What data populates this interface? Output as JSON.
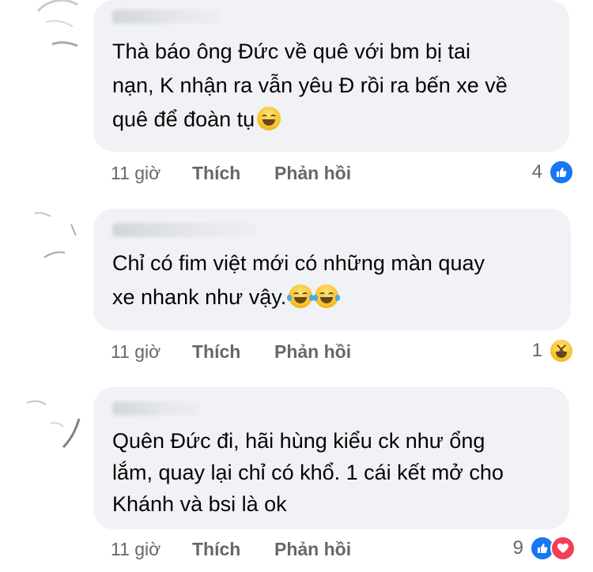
{
  "comments": [
    {
      "text": "Thà báo ông Đức về quê với bm bị tai\nnạn, K nhận ra vẫn yêu Đ rồi ra bến xe về\nquê để đoàn tụ",
      "emoji": "grinning-face-emoji",
      "time": "11 giờ",
      "like_label": "Thích",
      "reply_label": "Phản hồi",
      "reaction_count": "4",
      "reactions": [
        "like"
      ]
    },
    {
      "text": "Chỉ có fim việt mới có những màn quay\nxe nhank như vậy.",
      "emoji": "tears-of-joy-emoji",
      "time": "11 giờ",
      "like_label": "Thích",
      "reply_label": "Phản hồi",
      "reaction_count": "1",
      "reactions": [
        "haha"
      ]
    },
    {
      "text": "Quên Đức đi, hãi hùng kiểu ck như ổng\nlắm, quay lại chỉ có khổ. 1 cái kết mở cho\nKhánh và bsi là ok",
      "time": "11 giờ",
      "like_label": "Thích",
      "reply_label": "Phản hồi",
      "reaction_count": "9",
      "reactions": [
        "like",
        "love"
      ]
    }
  ],
  "colors": {
    "bubble": "#f0f2f5",
    "text": "#050505",
    "meta": "#65676b",
    "like_blue": "#1877f2",
    "love_red": "#f33e58"
  }
}
